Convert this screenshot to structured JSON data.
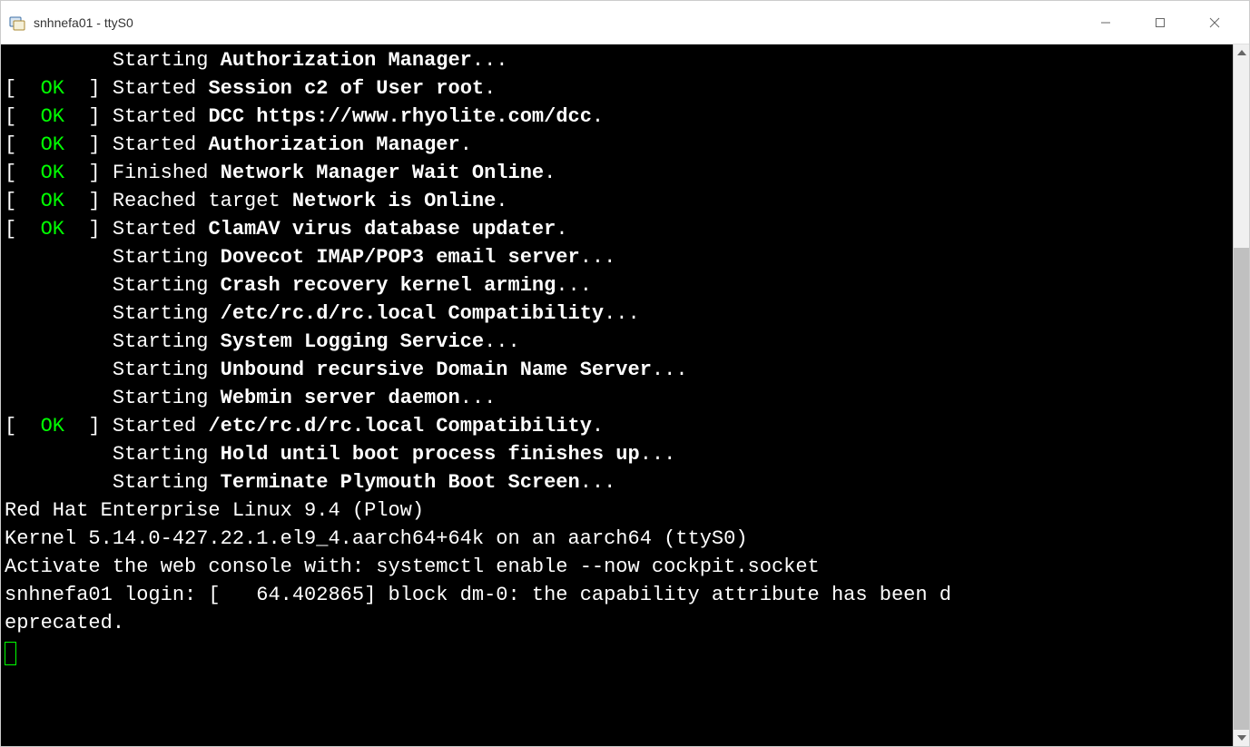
{
  "titlebar": {
    "title": "snhnefa01 - ttyS0"
  },
  "status": {
    "ok_label": "OK"
  },
  "boot_lines": [
    {
      "status": null,
      "indent": "         ",
      "verb": "Starting",
      "bold_service": "Authorization Manager",
      "suffix": "..."
    },
    {
      "status": "ok",
      "indent": "",
      "verb": "Started",
      "bold_service": "Session c2 of User root",
      "suffix": "."
    },
    {
      "status": "ok",
      "indent": "",
      "verb": "Started",
      "bold_service": "DCC https://www.rhyolite.com/dcc",
      "suffix": "."
    },
    {
      "status": "ok",
      "indent": "",
      "verb": "Started",
      "bold_service": "Authorization Manager",
      "suffix": "."
    },
    {
      "status": "ok",
      "indent": "",
      "verb": "Finished",
      "bold_service": "Network Manager Wait Online",
      "suffix": "."
    },
    {
      "status": "ok",
      "indent": "",
      "verb": "Reached target",
      "bold_service": "Network is Online",
      "suffix": "."
    },
    {
      "status": "ok",
      "indent": "",
      "verb": "Started",
      "bold_service": "ClamAV virus database updater",
      "suffix": "."
    },
    {
      "status": null,
      "indent": "         ",
      "verb": "Starting",
      "bold_service": "Dovecot IMAP/POP3 email server",
      "suffix": "..."
    },
    {
      "status": null,
      "indent": "         ",
      "verb": "Starting",
      "bold_service": "Crash recovery kernel arming",
      "suffix": "..."
    },
    {
      "status": null,
      "indent": "         ",
      "verb": "Starting",
      "bold_service": "/etc/rc.d/rc.local Compatibility",
      "suffix": "..."
    },
    {
      "status": null,
      "indent": "         ",
      "verb": "Starting",
      "bold_service": "System Logging Service",
      "suffix": "..."
    },
    {
      "status": null,
      "indent": "         ",
      "verb": "Starting",
      "bold_service": "Unbound recursive Domain Name Server",
      "suffix": "..."
    },
    {
      "status": null,
      "indent": "         ",
      "verb": "Starting",
      "bold_service": "Webmin server daemon",
      "suffix": "..."
    },
    {
      "status": "ok",
      "indent": "",
      "verb": "Started",
      "bold_service": "/etc/rc.d/rc.local Compatibility",
      "suffix": "."
    },
    {
      "status": null,
      "indent": "         ",
      "verb": "Starting",
      "bold_service": "Hold until boot process finishes up",
      "suffix": "..."
    },
    {
      "status": null,
      "indent": "         ",
      "verb": "Starting",
      "bold_service": "Terminate Plymouth Boot Screen",
      "suffix": "..."
    }
  ],
  "footer": {
    "blank1": "",
    "os_line": "Red Hat Enterprise Linux 9.4 (Plow)",
    "kernel_line": "Kernel 5.14.0-427.22.1.el9_4.aarch64+64k on an aarch64 (ttyS0)",
    "blank2": "",
    "activate_line": "Activate the web console with: systemctl enable --now cockpit.socket",
    "blank3": "",
    "login_line": "snhnefa01 login: [   64.402865] block dm-0: the capability attribute has been d",
    "login_line2": "eprecated."
  },
  "scrollbar": {
    "thumb_top_pct": 28,
    "thumb_height_pct": 72
  }
}
